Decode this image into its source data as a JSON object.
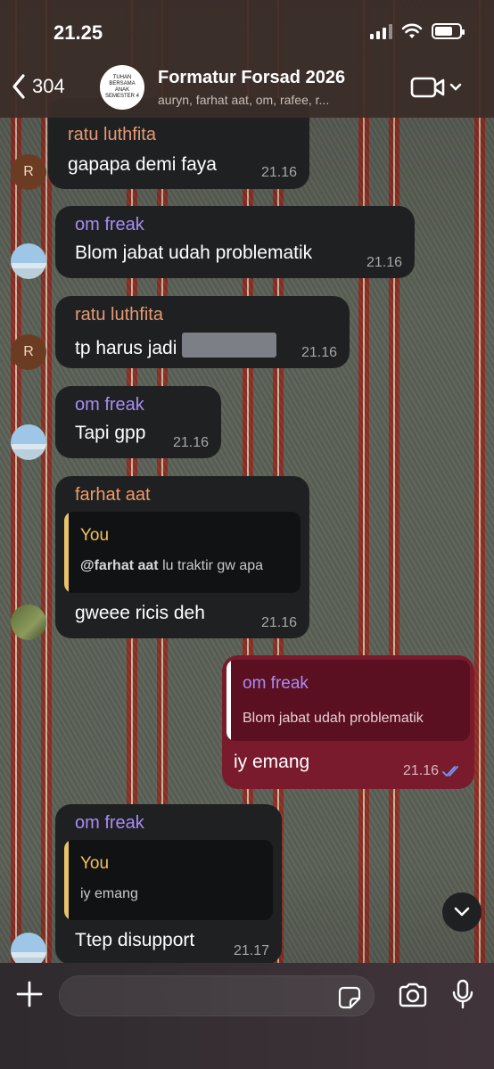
{
  "status": {
    "time": "21.25"
  },
  "header": {
    "back_count": "304",
    "group_avatar_text": "TUHAN BERSAMA ANAK SEMESTER 4",
    "title": "Formatur Forsad 2026",
    "members": "auryn, farhat aat, om, rafee, r..."
  },
  "colors": {
    "ratu": "#e59a73",
    "om": "#a98cf6",
    "farhat": "#f29a6b",
    "quote_you": "#f1c25e",
    "mine_bubble": "#7a1a2d",
    "read_ticks": "#6aa0ff"
  },
  "messages": [
    {
      "sender": "ratu luthfita",
      "text": "gapapa demi faya",
      "time": "21.16",
      "avatar_letter": "R"
    },
    {
      "sender": "om freak",
      "text": "Blom jabat udah problematik",
      "time": "21.16"
    },
    {
      "sender": "ratu luthfita",
      "text": "tp harus jadi",
      "time": "21.16",
      "avatar_letter": "R"
    },
    {
      "sender": "om freak",
      "text": "Tapi gpp",
      "time": "21.16"
    },
    {
      "sender": "farhat aat",
      "quote": {
        "name": "You",
        "mention": "@farhat aat",
        "text": " lu traktir gw apa"
      },
      "text": "gweee ricis deh",
      "time": "21.16"
    },
    {
      "mine": true,
      "quote": {
        "name": "om freak",
        "text": "Blom jabat udah problematik"
      },
      "text": "iy emang",
      "time": "21.16"
    },
    {
      "sender": "om freak",
      "quote": {
        "name": "You",
        "text": "iy emang"
      },
      "text": "Ttep disupport",
      "time": "21.17"
    }
  ],
  "icons": {
    "back": "chevron-left-icon",
    "video": "video-camera-icon",
    "scroll": "chevron-down-icon",
    "plus": "plus-icon",
    "sticker": "sticker-icon",
    "camera": "camera-icon",
    "mic": "microphone-icon"
  }
}
